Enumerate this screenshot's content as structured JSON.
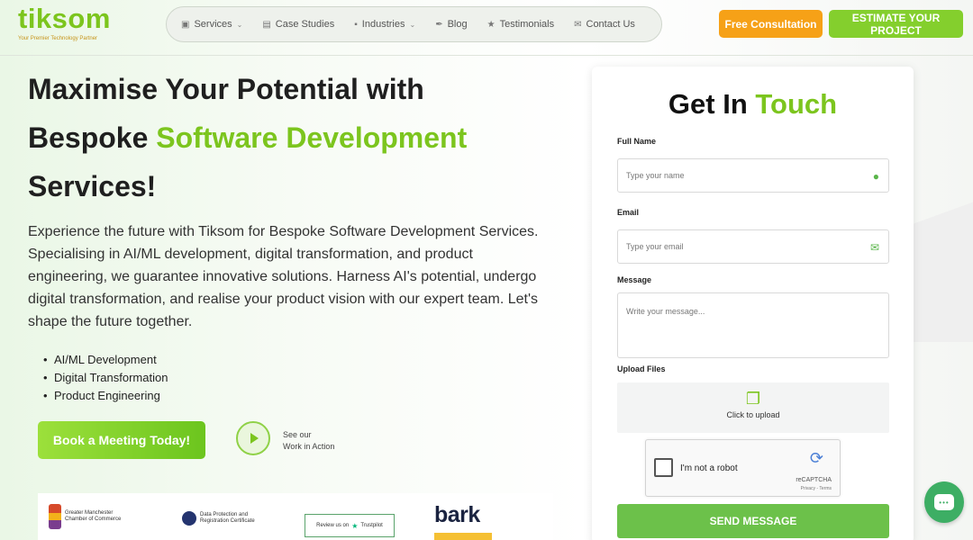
{
  "brand": {
    "name": "tiksom",
    "tagline": "Your Premier Technology Partner",
    "accent": "#7cc51e"
  },
  "nav": {
    "items": [
      {
        "label": "Services",
        "icon": "briefcase-icon",
        "dropdown": true
      },
      {
        "label": "Case Studies",
        "icon": "book-icon",
        "dropdown": false
      },
      {
        "label": "Industries",
        "icon": "factory-icon",
        "dropdown": true
      },
      {
        "label": "Blog",
        "icon": "feather-icon",
        "dropdown": false
      },
      {
        "label": "Testimonials",
        "icon": "star-icon",
        "dropdown": false
      },
      {
        "label": "Contact Us",
        "icon": "envelope-icon",
        "dropdown": false
      }
    ]
  },
  "header": {
    "free_consultation": "Free Consultation",
    "estimate": "ESTIMATE YOUR PROJECT",
    "free_color": "#f6a117",
    "estimate_color": "#84cf2d"
  },
  "hero": {
    "line1": "Maximise Your Potential with",
    "line2_a": "Bespoke ",
    "line2_b": "Software Development",
    "line3": "Services!",
    "description": "Experience the future with Tiksom for Bespoke Software Development Services. Specialising in AI/ML development, digital transformation, and product engineering, we guarantee innovative solutions. Harness AI's potential, undergo digital transformation, and realise your product vision with our expert team. Let's shape the future together.",
    "bullets": [
      "AI/ML Development",
      "Digital Transformation",
      "Product Engineering"
    ],
    "book_button": "Book a Meeting Today!",
    "see_line1": "See our",
    "see_line2": "Work in Action"
  },
  "partners": {
    "chamber": "Greater Manchester Chamber of Commerce",
    "dpr": "Data Protection and Registration Certificate",
    "trustpilot_prefix": "Review us on",
    "trustpilot": "Trustpilot",
    "bark": "bark"
  },
  "form": {
    "title_a": "Get In ",
    "title_b": "Touch",
    "full_name_label": "Full Name",
    "name_placeholder": "Type your name",
    "email_label": "Email",
    "email_placeholder": "Type your email",
    "message_label": "Message",
    "message_placeholder": "Write your message...",
    "upload_label": "Upload Files",
    "upload_text": "Click to upload",
    "captcha_label": "I'm not a robot",
    "captcha_brand": "reCAPTCHA",
    "captcha_terms": "Privacy - Terms",
    "send_button": "SEND MESSAGE",
    "send_color": "#6cc14a"
  },
  "chat": {
    "icon": "chat-icon"
  }
}
